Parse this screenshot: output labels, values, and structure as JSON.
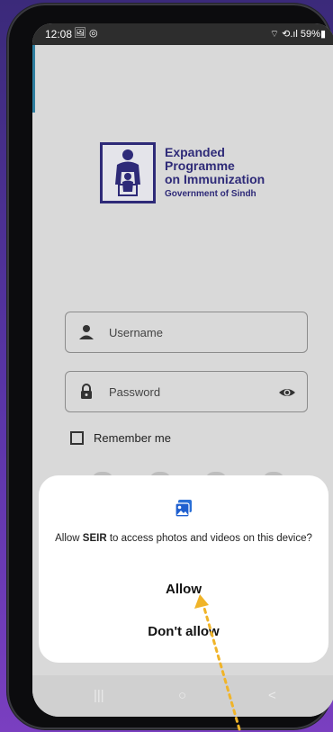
{
  "status_bar": {
    "time": "12:08",
    "notification_icons": "🖼 ◎",
    "right_text": "⌔ ⟲.ıl 59%▮"
  },
  "logo": {
    "line1": "Expanded",
    "line2": "Programme",
    "line3": "on Immunization",
    "line4": "Government of Sindh"
  },
  "login": {
    "username_placeholder": "Username",
    "password_placeholder": "Password",
    "remember_label": "Remember me"
  },
  "dialog": {
    "message_prefix": "Allow ",
    "app_name": "SEIR",
    "message_suffix": " to access photos and videos on this device?",
    "allow_label": "Allow",
    "deny_label": "Don't allow"
  },
  "nav": {
    "recents": "|||",
    "home": "○",
    "back": "<"
  },
  "colors": {
    "brand": "#2e2a78",
    "annotation_arrow": "#f0b429",
    "accent": "#2f7fa0"
  }
}
